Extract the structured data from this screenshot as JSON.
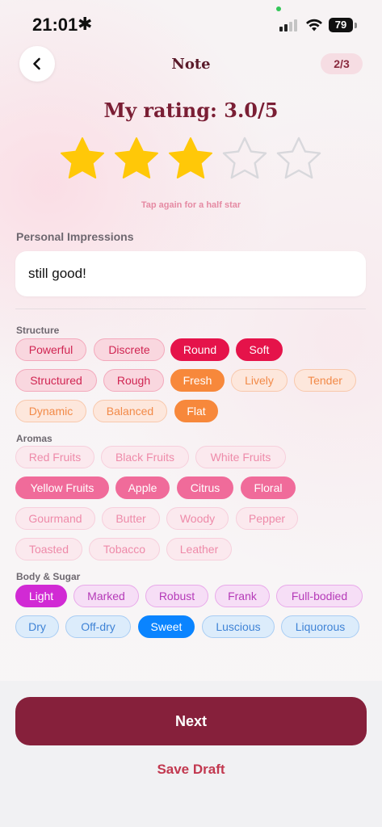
{
  "status_bar": {
    "time": "21:01",
    "time_symbol": "✱",
    "battery": "79"
  },
  "header": {
    "title": "Note",
    "step": "2/3",
    "back_icon": "chevron-left-icon"
  },
  "rating": {
    "title": "My rating: 3.0/5",
    "value": 3.0,
    "max": 5,
    "hint": "Tap again for a half star",
    "filled_color": "#ffc808"
  },
  "impressions": {
    "label": "Personal Impressions",
    "value": "still good!"
  },
  "structure": {
    "label": "Structure",
    "chips": [
      {
        "label": "Powerful",
        "selected": false
      },
      {
        "label": "Discrete",
        "selected": false
      },
      {
        "label": "Round",
        "selected": true
      },
      {
        "label": "Soft",
        "selected": true
      },
      {
        "label": "Structured",
        "selected": false
      },
      {
        "label": "Rough",
        "selected": false
      },
      {
        "label": "Fresh",
        "selected": true
      },
      {
        "label": "Lively",
        "selected": false
      },
      {
        "label": "Tender",
        "selected": false
      },
      {
        "label": "Dynamic",
        "selected": false
      },
      {
        "label": "Balanced",
        "selected": false
      },
      {
        "label": "Flat",
        "selected": true
      }
    ]
  },
  "aromas": {
    "label": "Aromas",
    "chips": [
      {
        "label": "Red Fruits",
        "selected": false
      },
      {
        "label": "Black Fruits",
        "selected": false
      },
      {
        "label": "White Fruits",
        "selected": false
      },
      {
        "label": "Yellow Fruits",
        "selected": true
      },
      {
        "label": "Apple",
        "selected": true
      },
      {
        "label": "Citrus",
        "selected": true
      },
      {
        "label": "Floral",
        "selected": true
      },
      {
        "label": "Gourmand",
        "selected": false
      },
      {
        "label": "Butter",
        "selected": false
      },
      {
        "label": "Woody",
        "selected": false
      },
      {
        "label": "Pepper",
        "selected": false
      },
      {
        "label": "Toasted",
        "selected": false
      },
      {
        "label": "Tobacco",
        "selected": false
      },
      {
        "label": "Leather",
        "selected": false
      }
    ]
  },
  "body_sugar": {
    "label": "Body & Sugar",
    "chips": [
      {
        "label": "Light",
        "selected": true
      },
      {
        "label": "Marked",
        "selected": false
      },
      {
        "label": "Robust",
        "selected": false
      },
      {
        "label": "Frank",
        "selected": false
      },
      {
        "label": "Full-bodied",
        "selected": false
      },
      {
        "label": "Dry",
        "selected": false
      },
      {
        "label": "Off-dry",
        "selected": false
      },
      {
        "label": "Sweet",
        "selected": true
      },
      {
        "label": "Luscious",
        "selected": false
      },
      {
        "label": "Liquorous",
        "selected": false
      }
    ]
  },
  "actions": {
    "next": "Next",
    "save_draft": "Save Draft"
  },
  "colors": {
    "primary": "#86203b",
    "structure_red": "#e5134a",
    "structure_orange": "#f7883b",
    "aroma_pink": "#f06b9a",
    "body_purple": "#d12ad4",
    "sugar_blue": "#0a84ff"
  }
}
